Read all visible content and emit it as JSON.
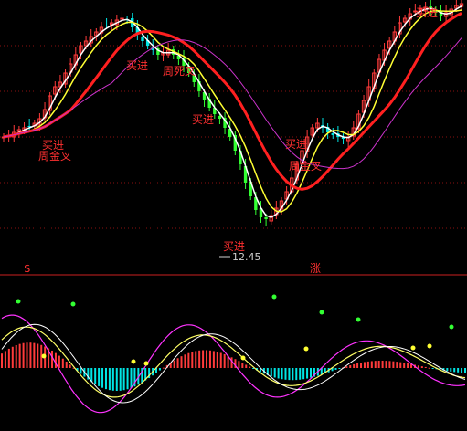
{
  "chart_data": [
    {
      "type": "candlestick",
      "panel": "price",
      "labels": {
        "buy_top": "买进",
        "dead_cross": "周死叉",
        "buy_bottom": "买进",
        "low_price": "12.45",
        "golden_cross_left": "周金叉",
        "golden_cross_right": "周金叉",
        "side_s": "$",
        "side_zhang": "涨"
      },
      "colors": {
        "up": "#ff3b3b",
        "down": "#00e5e5",
        "strong_down": "#33ff33",
        "ma_white": "#ffffff",
        "ma_yellow": "#ffff33",
        "ma_red": "#ff2020",
        "ma_magenta": "#cc33cc",
        "label": "#ff3030"
      }
    },
    {
      "type": "macd",
      "panel": "indicator",
      "colors": {
        "dif": "#ff33ff",
        "dea": "#ffff66",
        "signal": "#ffffff",
        "hist_pos": "#ff3b3b",
        "hist_neg": "#00e5e5",
        "dot_green": "#33ff33",
        "dot_yellow": "#ffff33"
      }
    }
  ]
}
